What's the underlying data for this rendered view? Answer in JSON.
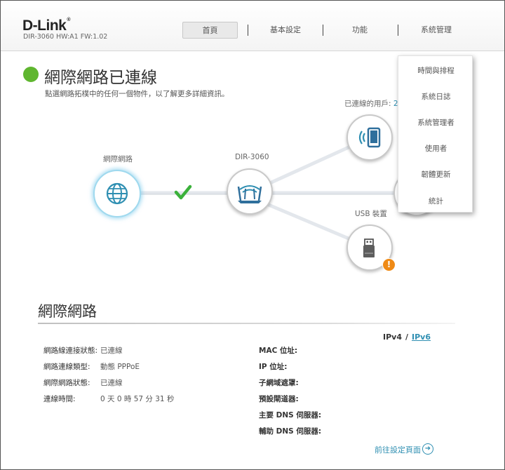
{
  "header": {
    "brand": "D-Link",
    "model_info": "DIR-3060 HW:A1 FW:1.02",
    "nav": [
      {
        "label": "首頁"
      },
      {
        "label": "基本設定"
      },
      {
        "label": "功能"
      },
      {
        "label": "系統管理"
      }
    ]
  },
  "admin_menu": {
    "items": [
      {
        "label": "時間與排程"
      },
      {
        "label": "系統日誌"
      },
      {
        "label": "系統管理者"
      },
      {
        "label": "使用者"
      },
      {
        "label": "韌體更新"
      },
      {
        "label": "統計"
      }
    ]
  },
  "status": {
    "title": "網際網路已連線",
    "subtitle": "點選網路拓樸中的任何一個物件，以了解更多詳細資訊。",
    "color": "#5fb62f"
  },
  "topology": {
    "internet_label": "網際網路",
    "router_label": "DIR-3060",
    "clients_label": "已連線的用戶:",
    "clients_count": "2",
    "usb_label": "USB 裝置",
    "warning_symbol": "!",
    "link_status_icon": "check-icon",
    "accent": "#4fb3d9"
  },
  "section": {
    "title": "網際網路",
    "ipv4_label": "IPv4",
    "separator": "/",
    "ipv6_label": "IPv6",
    "left": [
      {
        "label": "網路線連接狀態:",
        "value": "已連線"
      },
      {
        "label": "網路連線類型:",
        "value": "動態 PPPoE"
      },
      {
        "label": "網際網路狀態:",
        "value": "已連線"
      },
      {
        "label": "連線時間:",
        "value": "0 天 0 時 57 分 31 秒"
      }
    ],
    "right": [
      {
        "label": "MAC 位址:",
        "value": ""
      },
      {
        "label": "IP 位址:",
        "value": ""
      },
      {
        "label": "子網域遮罩:",
        "value": ""
      },
      {
        "label": "預設閘道器:",
        "value": ""
      },
      {
        "label": "主要 DNS 伺服器:",
        "value": ""
      },
      {
        "label": "輔助 DNS 伺服器:",
        "value": ""
      }
    ],
    "goto_label": "前往設定頁面"
  }
}
